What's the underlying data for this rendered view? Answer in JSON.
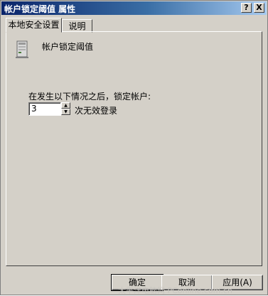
{
  "window": {
    "title": "帐户锁定阈值 属性"
  },
  "titlebar_buttons": {
    "help": "?",
    "close": "X"
  },
  "tabs": [
    {
      "label": "本地安全设置"
    },
    {
      "label": "说明"
    }
  ],
  "policy": {
    "name": "帐户锁定阈值",
    "icon": "server-computer-icon"
  },
  "setting": {
    "prompt": "在发生以下情况之后，锁定帐户:",
    "value": "3",
    "suffix": "次无效登录"
  },
  "buttons": {
    "ok": "确定",
    "cancel": "取消",
    "apply": "应用(A)"
  },
  "watermark": "太平洋电脑网 PConline.com.cn"
}
